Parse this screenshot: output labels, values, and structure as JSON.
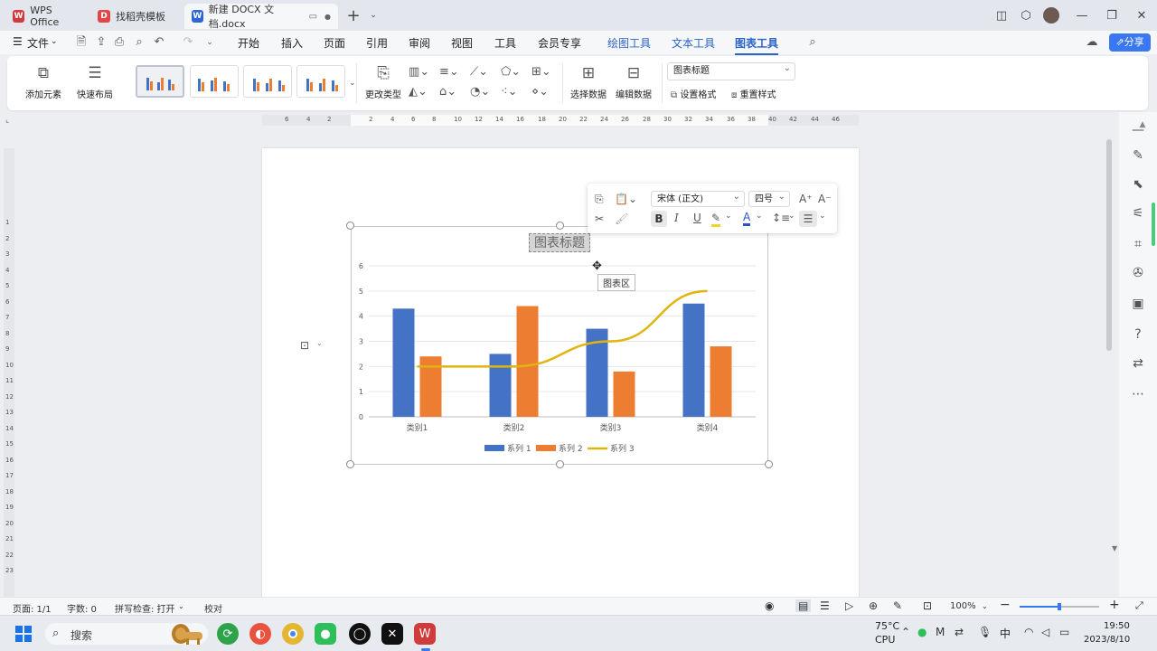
{
  "tabs": [
    {
      "label": "WPS Office",
      "icon": "wps-icon",
      "color": "#d23b3b"
    },
    {
      "label": "找稻壳模板",
      "icon": "docer-icon",
      "color": "#e04848"
    },
    {
      "label": "新建 DOCX 文档.docx",
      "icon": "word-doc-icon",
      "color": "#2f66d3"
    }
  ],
  "menu": {
    "file_label": "文件",
    "items": [
      "开始",
      "插入",
      "页面",
      "引用",
      "审阅",
      "视图",
      "工具",
      "会员专享"
    ],
    "context_tabs": [
      "绘图工具",
      "文本工具",
      "图表工具"
    ],
    "active_tab": "图表工具",
    "share_label": "分享"
  },
  "ribbon": {
    "add_element": "添加元素",
    "quick_layout": "快速布局",
    "change_type": "更改类型",
    "select_data": "选择数据",
    "edit_data": "编辑数据",
    "element_select_value": "图表标题",
    "set_format": "设置格式",
    "reset_style": "重置样式"
  },
  "floatbar": {
    "font_value": "宋体 (正文)",
    "size_value": "四号",
    "bold": "B",
    "italic": "I",
    "underline": "U",
    "font_color": "A"
  },
  "chart_data": {
    "type": "bar",
    "title": "图表标题",
    "categories": [
      "类别1",
      "类别2",
      "类别3",
      "类别4"
    ],
    "series": [
      {
        "name": "系列 1",
        "type": "bar",
        "color": "#4472c4",
        "values": [
          4.3,
          2.5,
          3.5,
          4.5
        ]
      },
      {
        "name": "系列 2",
        "type": "bar",
        "color": "#ed7d31",
        "values": [
          2.4,
          4.4,
          1.8,
          2.8
        ]
      },
      {
        "name": "系列 3",
        "type": "line",
        "color": "#e1b40f",
        "values": [
          2,
          2,
          3,
          5
        ]
      }
    ],
    "ylim": [
      0,
      6
    ],
    "yticks": [
      0,
      1,
      2,
      3,
      4,
      5,
      6
    ],
    "grid": true,
    "legend_position": "bottom"
  },
  "tooltip": "图表区",
  "status": {
    "page": "页面: 1/1",
    "words": "字数: 0",
    "spell": "拼写检查: 打开",
    "proofread": "校对",
    "zoom": "100%"
  },
  "taskbar": {
    "search_placeholder": "搜索",
    "temp": "75°C",
    "cpu": "CPU",
    "ime": "中",
    "time": "19:50",
    "date": "2023/8/10"
  },
  "hruler_ticks": [
    "6",
    "4",
    "2",
    "2",
    "4",
    "6",
    "8",
    "10",
    "12",
    "14",
    "16",
    "18",
    "20",
    "22",
    "24",
    "26",
    "28",
    "30",
    "32",
    "34",
    "36",
    "38",
    "40",
    "42",
    "44",
    "46"
  ],
  "vruler_ticks": [
    "4",
    "3",
    "2",
    "1",
    "1",
    "2",
    "3",
    "4",
    "5",
    "6",
    "7",
    "8",
    "9",
    "10",
    "11",
    "12",
    "13",
    "14",
    "15",
    "16",
    "17",
    "18",
    "19",
    "20",
    "21",
    "22",
    "23"
  ]
}
